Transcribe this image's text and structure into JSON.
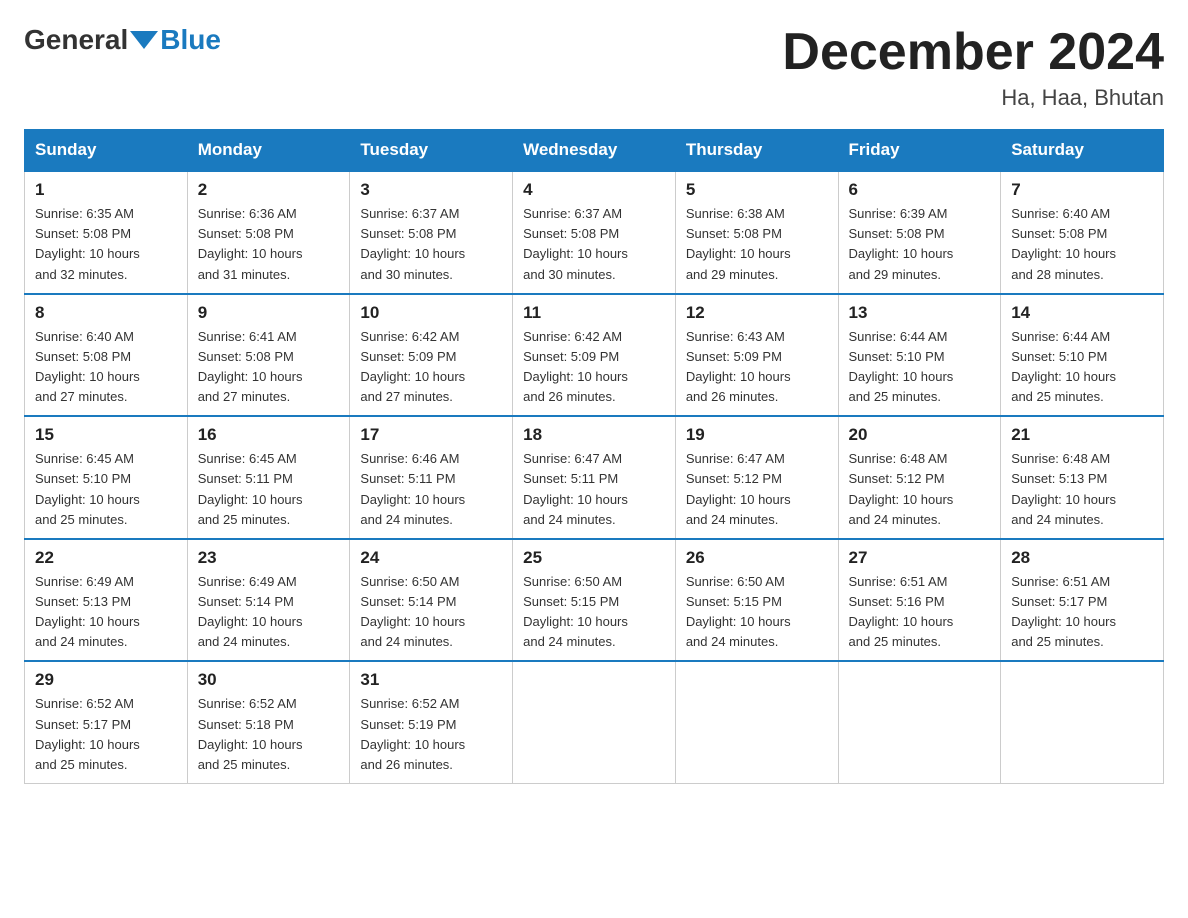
{
  "header": {
    "logo_general": "General",
    "logo_blue": "Blue",
    "title": "December 2024",
    "location": "Ha, Haa, Bhutan"
  },
  "days_of_week": [
    "Sunday",
    "Monday",
    "Tuesday",
    "Wednesday",
    "Thursday",
    "Friday",
    "Saturday"
  ],
  "weeks": [
    [
      {
        "day": "1",
        "sunrise": "6:35 AM",
        "sunset": "5:08 PM",
        "daylight": "10 hours and 32 minutes."
      },
      {
        "day": "2",
        "sunrise": "6:36 AM",
        "sunset": "5:08 PM",
        "daylight": "10 hours and 31 minutes."
      },
      {
        "day": "3",
        "sunrise": "6:37 AM",
        "sunset": "5:08 PM",
        "daylight": "10 hours and 30 minutes."
      },
      {
        "day": "4",
        "sunrise": "6:37 AM",
        "sunset": "5:08 PM",
        "daylight": "10 hours and 30 minutes."
      },
      {
        "day": "5",
        "sunrise": "6:38 AM",
        "sunset": "5:08 PM",
        "daylight": "10 hours and 29 minutes."
      },
      {
        "day": "6",
        "sunrise": "6:39 AM",
        "sunset": "5:08 PM",
        "daylight": "10 hours and 29 minutes."
      },
      {
        "day": "7",
        "sunrise": "6:40 AM",
        "sunset": "5:08 PM",
        "daylight": "10 hours and 28 minutes."
      }
    ],
    [
      {
        "day": "8",
        "sunrise": "6:40 AM",
        "sunset": "5:08 PM",
        "daylight": "10 hours and 27 minutes."
      },
      {
        "day": "9",
        "sunrise": "6:41 AM",
        "sunset": "5:08 PM",
        "daylight": "10 hours and 27 minutes."
      },
      {
        "day": "10",
        "sunrise": "6:42 AM",
        "sunset": "5:09 PM",
        "daylight": "10 hours and 27 minutes."
      },
      {
        "day": "11",
        "sunrise": "6:42 AM",
        "sunset": "5:09 PM",
        "daylight": "10 hours and 26 minutes."
      },
      {
        "day": "12",
        "sunrise": "6:43 AM",
        "sunset": "5:09 PM",
        "daylight": "10 hours and 26 minutes."
      },
      {
        "day": "13",
        "sunrise": "6:44 AM",
        "sunset": "5:10 PM",
        "daylight": "10 hours and 25 minutes."
      },
      {
        "day": "14",
        "sunrise": "6:44 AM",
        "sunset": "5:10 PM",
        "daylight": "10 hours and 25 minutes."
      }
    ],
    [
      {
        "day": "15",
        "sunrise": "6:45 AM",
        "sunset": "5:10 PM",
        "daylight": "10 hours and 25 minutes."
      },
      {
        "day": "16",
        "sunrise": "6:45 AM",
        "sunset": "5:11 PM",
        "daylight": "10 hours and 25 minutes."
      },
      {
        "day": "17",
        "sunrise": "6:46 AM",
        "sunset": "5:11 PM",
        "daylight": "10 hours and 24 minutes."
      },
      {
        "day": "18",
        "sunrise": "6:47 AM",
        "sunset": "5:11 PM",
        "daylight": "10 hours and 24 minutes."
      },
      {
        "day": "19",
        "sunrise": "6:47 AM",
        "sunset": "5:12 PM",
        "daylight": "10 hours and 24 minutes."
      },
      {
        "day": "20",
        "sunrise": "6:48 AM",
        "sunset": "5:12 PM",
        "daylight": "10 hours and 24 minutes."
      },
      {
        "day": "21",
        "sunrise": "6:48 AM",
        "sunset": "5:13 PM",
        "daylight": "10 hours and 24 minutes."
      }
    ],
    [
      {
        "day": "22",
        "sunrise": "6:49 AM",
        "sunset": "5:13 PM",
        "daylight": "10 hours and 24 minutes."
      },
      {
        "day": "23",
        "sunrise": "6:49 AM",
        "sunset": "5:14 PM",
        "daylight": "10 hours and 24 minutes."
      },
      {
        "day": "24",
        "sunrise": "6:50 AM",
        "sunset": "5:14 PM",
        "daylight": "10 hours and 24 minutes."
      },
      {
        "day": "25",
        "sunrise": "6:50 AM",
        "sunset": "5:15 PM",
        "daylight": "10 hours and 24 minutes."
      },
      {
        "day": "26",
        "sunrise": "6:50 AM",
        "sunset": "5:15 PM",
        "daylight": "10 hours and 24 minutes."
      },
      {
        "day": "27",
        "sunrise": "6:51 AM",
        "sunset": "5:16 PM",
        "daylight": "10 hours and 25 minutes."
      },
      {
        "day": "28",
        "sunrise": "6:51 AM",
        "sunset": "5:17 PM",
        "daylight": "10 hours and 25 minutes."
      }
    ],
    [
      {
        "day": "29",
        "sunrise": "6:52 AM",
        "sunset": "5:17 PM",
        "daylight": "10 hours and 25 minutes."
      },
      {
        "day": "30",
        "sunrise": "6:52 AM",
        "sunset": "5:18 PM",
        "daylight": "10 hours and 25 minutes."
      },
      {
        "day": "31",
        "sunrise": "6:52 AM",
        "sunset": "5:19 PM",
        "daylight": "10 hours and 26 minutes."
      },
      null,
      null,
      null,
      null
    ]
  ],
  "labels": {
    "sunrise": "Sunrise:",
    "sunset": "Sunset:",
    "daylight": "Daylight:"
  }
}
